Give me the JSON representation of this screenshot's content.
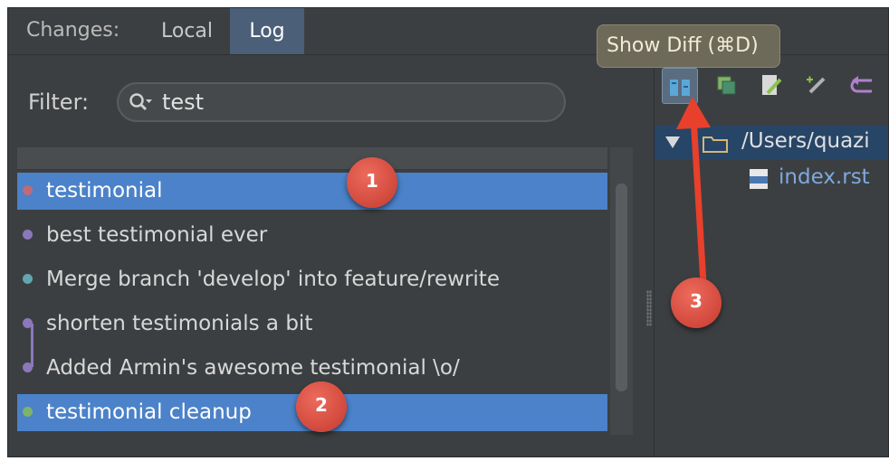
{
  "tabs": {
    "prefix": "Changes:",
    "items": [
      {
        "label": "Local",
        "active": false
      },
      {
        "label": "Log",
        "active": true
      }
    ]
  },
  "filter": {
    "label": "Filter:",
    "value": "test"
  },
  "commits": [
    {
      "message": "testimonial",
      "selected": true,
      "dot_color": "#c06a78"
    },
    {
      "message": "best testimonial ever",
      "selected": false,
      "dot_color": "#8b78bb"
    },
    {
      "message": "Merge branch 'develop' into feature/rewrite",
      "selected": false,
      "dot_color": "#63a6b0"
    },
    {
      "message": "shorten testimonials a bit",
      "selected": false,
      "dot_color": "#8b78bb"
    },
    {
      "message": "Added Armin's awesome testimonial \\o/",
      "selected": false,
      "dot_color": "#8b78bb"
    },
    {
      "message": "testimonial cleanup",
      "selected": true,
      "dot_color": "#7fb36a"
    }
  ],
  "toolbar": {
    "icons": [
      "show-diff-icon",
      "copy-icon",
      "edit-source-icon",
      "edit-icon",
      "revert-icon"
    ],
    "tooltip": "Show Diff (⌘D)"
  },
  "tree": {
    "root": "/Users/quazi",
    "child": "index.rst"
  },
  "annotations": {
    "badge1": "1",
    "badge2": "2",
    "badge3": "3"
  },
  "colors": {
    "selection": "#4b82c9",
    "badge": "#d9483b",
    "arrow": "#e8402c",
    "tooltip_bg": "#6d6a5a"
  }
}
